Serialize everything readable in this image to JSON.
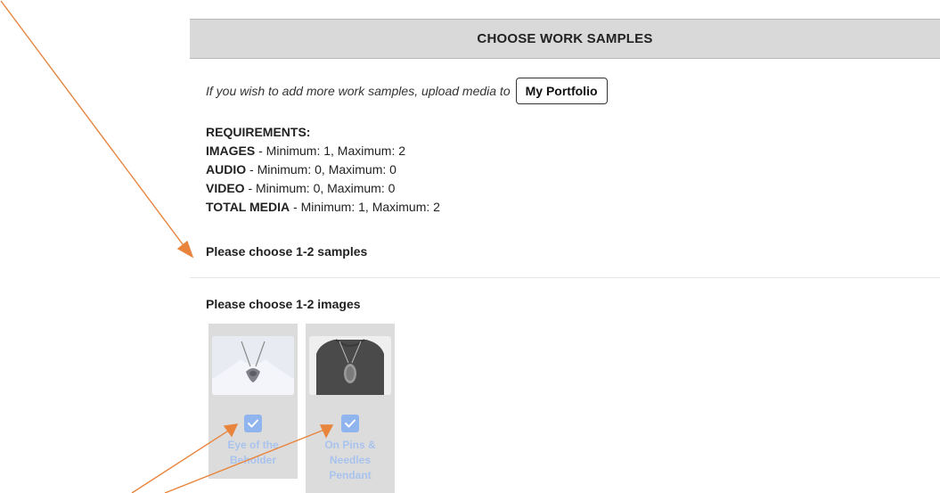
{
  "header": {
    "title": "CHOOSE WORK SAMPLES"
  },
  "intro": {
    "text": "If you wish to add more work samples, upload media to",
    "button_label": "My Portfolio"
  },
  "requirements": {
    "title": "REQUIREMENTS:",
    "items": [
      {
        "label": "IMAGES",
        "detail": " - Minimum: 1, Maximum: 2"
      },
      {
        "label": "AUDIO",
        "detail": " - Minimum: 0, Maximum: 0"
      },
      {
        "label": "VIDEO",
        "detail": " - Minimum: 0, Maximum: 0"
      },
      {
        "label": "TOTAL MEDIA",
        "detail": " - Minimum: 1, Maximum: 2"
      }
    ]
  },
  "samples_prompt": "Please choose 1-2 samples",
  "images_prompt": "Please choose 1-2 images",
  "samples": [
    {
      "title": "Eye of the Beholder",
      "checked": true
    },
    {
      "title": "On Pins & Needles Pendant",
      "checked": true
    }
  ],
  "colors": {
    "header_bg": "#d9d9d9",
    "card_bg": "#dcdcdc",
    "checkbox": "#8fb4ee",
    "card_label": "#a9c3ee",
    "annotation_arrow": "#e8843c"
  },
  "icons": [
    "checkmark-icon",
    "annotation-arrow"
  ]
}
